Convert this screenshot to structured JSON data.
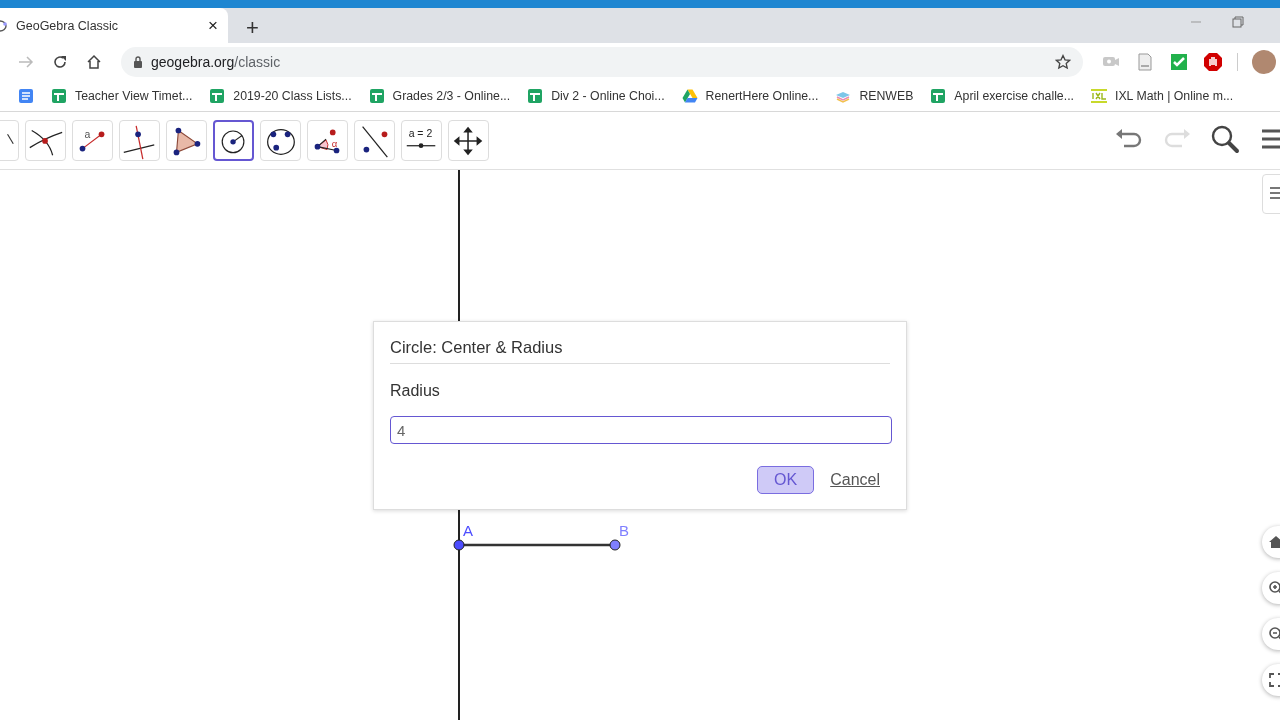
{
  "browser": {
    "tab": {
      "title": "GeoGebra Classic",
      "close": "×"
    },
    "new_tab": "+",
    "address": {
      "host": "geogebra.org",
      "path": "/classic"
    },
    "bookmarks": [
      {
        "kind": "docs"
      },
      {
        "kind": "sheets",
        "label": "Teacher View Timet..."
      },
      {
        "kind": "sheets",
        "label": "2019-20 Class Lists..."
      },
      {
        "kind": "sheets",
        "label": "Grades 2/3 - Online..."
      },
      {
        "kind": "sheets",
        "label": "Div 2 - Online Choi..."
      },
      {
        "kind": "drive",
        "label": "RenertHere Online..."
      },
      {
        "kind": "renweb",
        "label": "RENWEB"
      },
      {
        "kind": "sheets",
        "label": "April exercise challe..."
      },
      {
        "kind": "ixl",
        "label": "IXL Math | Online m..."
      }
    ]
  },
  "toolbar": {
    "tools": [
      {
        "kind": "partial",
        "selected": false
      },
      {
        "kind": "intersect",
        "selected": false
      },
      {
        "kind": "segment",
        "glyph": "a",
        "selected": false
      },
      {
        "kind": "perpendicular",
        "selected": false
      },
      {
        "kind": "polygon",
        "selected": false
      },
      {
        "kind": "circle",
        "selected": true
      },
      {
        "kind": "circle3",
        "selected": false
      },
      {
        "kind": "angle",
        "glyph": "α",
        "selected": false
      },
      {
        "kind": "reflect",
        "selected": false
      },
      {
        "kind": "slider",
        "glyph": "a = 2",
        "selected": false
      },
      {
        "kind": "move",
        "selected": false
      }
    ],
    "redo_disabled": true
  },
  "canvas": {
    "points": [
      {
        "label": "A",
        "color": "#4d4dff"
      },
      {
        "label": "B",
        "color": "#7f7fff"
      }
    ]
  },
  "dialog": {
    "title": "Circle: Center & Radius",
    "field_label": "Radius",
    "value": "4",
    "buttons": [
      {
        "label": "OK",
        "kind": "primary",
        "highlighted": true
      },
      {
        "label": "Cancel",
        "kind": "link",
        "highlighted": false
      }
    ]
  }
}
